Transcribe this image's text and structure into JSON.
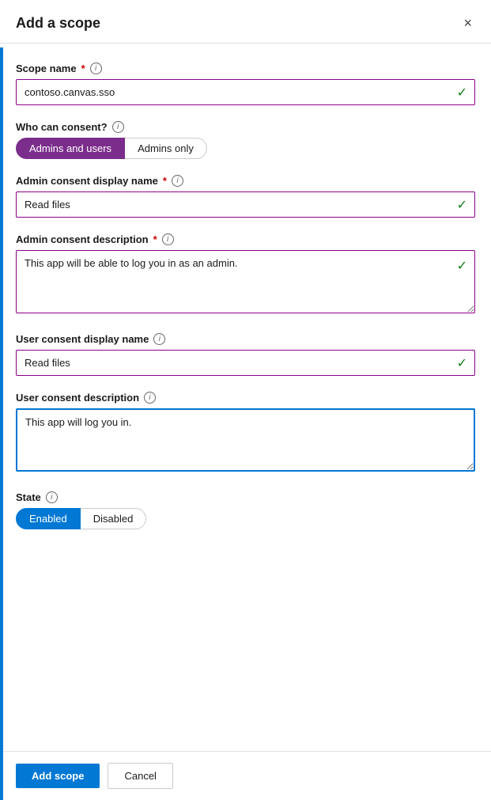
{
  "dialog": {
    "title": "Add a scope",
    "close_label": "×"
  },
  "form": {
    "scope_name": {
      "label": "Scope name",
      "required": true,
      "info": "i",
      "value": "contoso.canvas.sso"
    },
    "who_can_consent": {
      "label": "Who can consent?",
      "info": "i",
      "option1": "Admins and users",
      "option2": "Admins only"
    },
    "admin_consent_display_name": {
      "label": "Admin consent display name",
      "required": true,
      "info": "i",
      "value": "Read files"
    },
    "admin_consent_description": {
      "label": "Admin consent description",
      "required": true,
      "info": "i",
      "value": "This app will be able to log you in as an admin."
    },
    "user_consent_display_name": {
      "label": "User consent display name",
      "info": "i",
      "value": "Read files"
    },
    "user_consent_description": {
      "label": "User consent description",
      "info": "i",
      "value": "This app will log you in."
    },
    "state": {
      "label": "State",
      "info": "i",
      "option1": "Enabled",
      "option2": "Disabled"
    }
  },
  "footer": {
    "add_scope": "Add scope",
    "cancel": "Cancel"
  },
  "icons": {
    "check": "✓",
    "close": "✕",
    "info": "i"
  }
}
